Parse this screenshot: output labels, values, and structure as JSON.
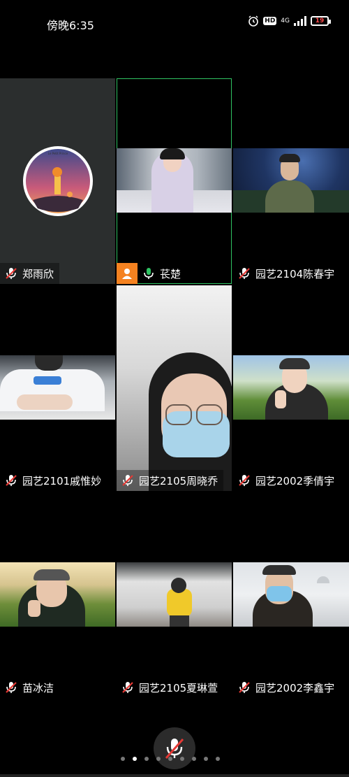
{
  "status_bar": {
    "time": "傍晚6:35",
    "hd_label": "HD",
    "network_label": "4G",
    "battery_level": "19",
    "battery_color": "#ff4a4a"
  },
  "participants": [
    {
      "name": "郑雨欣",
      "mic": "muted",
      "video": "avatar",
      "avatar_caption": "Le Petit Prince"
    },
    {
      "name": "苌楚",
      "mic": "active",
      "video": "on",
      "speaking": true
    },
    {
      "name": "园艺2104陈春宇",
      "mic": "muted",
      "video": "on"
    },
    {
      "name": "园艺2101戚惟妙",
      "mic": "muted",
      "video": "on"
    },
    {
      "name": "园艺2105周晓乔",
      "mic": "muted",
      "video": "on"
    },
    {
      "name": "园艺2002季倩宇",
      "mic": "muted",
      "video": "on"
    },
    {
      "name": "苗冰洁",
      "mic": "muted",
      "video": "on"
    },
    {
      "name": "园艺2105夏琳萱",
      "mic": "muted",
      "video": "on"
    },
    {
      "name": "园艺2002李鑫宇",
      "mic": "muted",
      "video": "on"
    }
  ],
  "controls": {
    "mute_button": "microphone-muted-icon"
  },
  "pagination": {
    "total_pages": 9,
    "current_page": 2
  },
  "colors": {
    "active_speaker_border": "#2fc463",
    "avatar_badge": "#f58220",
    "muted_mic": "#e53935"
  }
}
